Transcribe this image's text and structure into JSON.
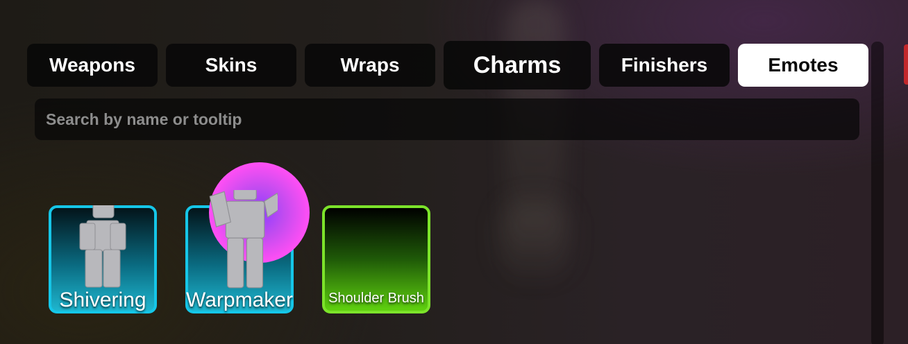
{
  "tabs": [
    {
      "label": "Weapons"
    },
    {
      "label": "Skins"
    },
    {
      "label": "Wraps"
    },
    {
      "label": "Charms"
    },
    {
      "label": "Finishers"
    },
    {
      "label": "Emotes",
      "selected": true
    }
  ],
  "search": {
    "placeholder": "Search by name or tooltip"
  },
  "items": [
    {
      "name": "Shivering",
      "rarity_color": "#15c6e8"
    },
    {
      "name": "Warpmaker",
      "rarity_color": "#15c6e8"
    },
    {
      "name": "Shoulder Brush",
      "rarity_color": "#7ce32a"
    }
  ],
  "colors": {
    "selected_tab_bg": "#ffffff",
    "tab_bg": "#080808"
  }
}
